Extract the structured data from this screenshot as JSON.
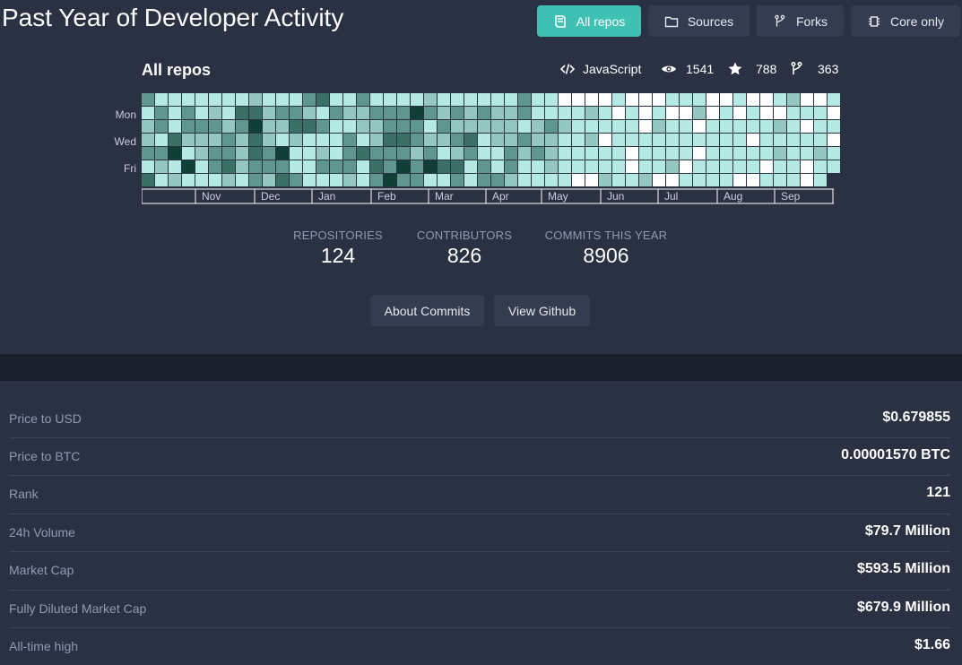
{
  "header": {
    "title": "Past Year of Developer Activity",
    "buttons": [
      {
        "label": "All repos",
        "icon": "book-icon",
        "active": true
      },
      {
        "label": "Sources",
        "icon": "folder-icon",
        "active": false
      },
      {
        "label": "Forks",
        "icon": "fork-icon",
        "active": false
      },
      {
        "label": "Core only",
        "icon": "chip-icon",
        "active": false
      }
    ]
  },
  "repo": {
    "title": "All repos",
    "language": "JavaScript",
    "watchers": "1541",
    "stars": "788",
    "forks": "363"
  },
  "heatmap": {
    "day_labels": [
      "Mon",
      "Wed",
      "Fri"
    ],
    "month_labels": [
      "Nov",
      "Dec",
      "Jan",
      "Feb",
      "Mar",
      "Apr",
      "May",
      "Jun",
      "Jul",
      "Aug",
      "Sep"
    ],
    "colors": {
      "empty": "#ffffff",
      "level1": "#b4eae3",
      "level2": "#94c7bf",
      "level3": "#5f968d",
      "level4": "#3a7066",
      "level5": "#0f3f36"
    }
  },
  "stats": [
    {
      "label": "REPOSITORIES",
      "value": "124"
    },
    {
      "label": "CONTRIBUTORS",
      "value": "826"
    },
    {
      "label": "COMMITS THIS YEAR",
      "value": "8906"
    }
  ],
  "actions": {
    "about_commits": "About Commits",
    "view_github": "View Github"
  },
  "market": [
    {
      "label": "Price to USD",
      "value": "$0.679855"
    },
    {
      "label": "Price to BTC",
      "value": "0.00001570 BTC"
    },
    {
      "label": "Rank",
      "value": "121"
    },
    {
      "label": "24h Volume",
      "value": "$79.7 Million"
    },
    {
      "label": "Market Cap",
      "value": "$593.5 Million"
    },
    {
      "label": "Fully Diluted Market Cap",
      "value": "$679.9 Million"
    },
    {
      "label": "All-time high",
      "value": "$1.66"
    }
  ],
  "colors": {
    "accent": "#3fc1b3",
    "background": "#2a3142",
    "band": "#1b1f2b",
    "muted_text": "#8f9bb3"
  }
}
